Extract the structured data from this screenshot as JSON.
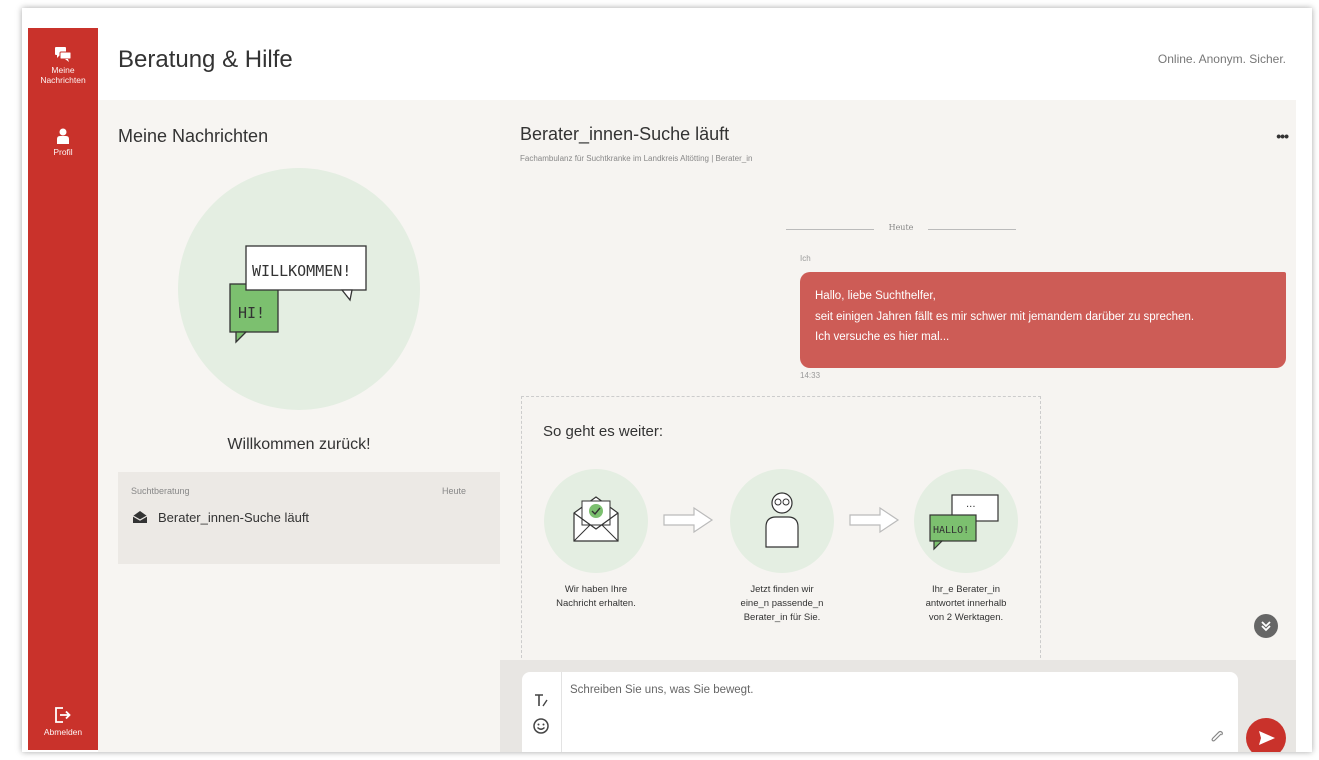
{
  "sidebar": {
    "items": [
      {
        "label_line1": "Meine",
        "label_line2": "Nachrichten",
        "icon": "chat-bubbles-icon"
      },
      {
        "label_line1": "Profil",
        "icon": "person-icon"
      }
    ],
    "logout_label": "Abmelden",
    "logout_icon": "logout-icon",
    "color": "#c9322b"
  },
  "header": {
    "title": "Beratung & Hilfe",
    "tagline": "Online. Anonym. Sicher."
  },
  "left": {
    "title": "Meine Nachrichten",
    "illustration_text_big": "WILLKOMMEN!",
    "illustration_text_small": "HI!",
    "welcome": "Willkommen zurück!",
    "session": {
      "topic": "Suchtberatung",
      "date": "Heute",
      "subject": "Berater_innen-Suche läuft",
      "icon": "envelope-open-icon"
    }
  },
  "chat": {
    "title": "Berater_innen-Suche läuft",
    "subtitle": "Fachambulanz für Suchtkranke im Landkreis Altötting  |  Berater_in",
    "divider": "Heute",
    "message": {
      "sender": "Ich",
      "lines": [
        "Hallo, liebe Suchthelfer,",
        "seit einigen Jahren fällt es mir schwer mit jemandem darüber zu sprechen.",
        "Ich versuche es hier mal..."
      ],
      "time": "14:33",
      "color": "#cd5c56"
    },
    "steps": {
      "title": "So geht es weiter:",
      "items": [
        {
          "line1": "Wir haben Ihre",
          "line2": "Nachricht erhalten.",
          "line3": ""
        },
        {
          "line1": "Jetzt finden wir",
          "line2": "eine_n passende_n",
          "line3": "Berater_in für Sie."
        },
        {
          "line1": "Ihr_e Berater_in",
          "line2": "antwortet innerhalb",
          "line3": "von 2 Werktagen."
        }
      ],
      "bubble_text": "HALLO!"
    },
    "composer": {
      "placeholder": "Schreiben Sie uns, was Sie bewegt."
    }
  }
}
